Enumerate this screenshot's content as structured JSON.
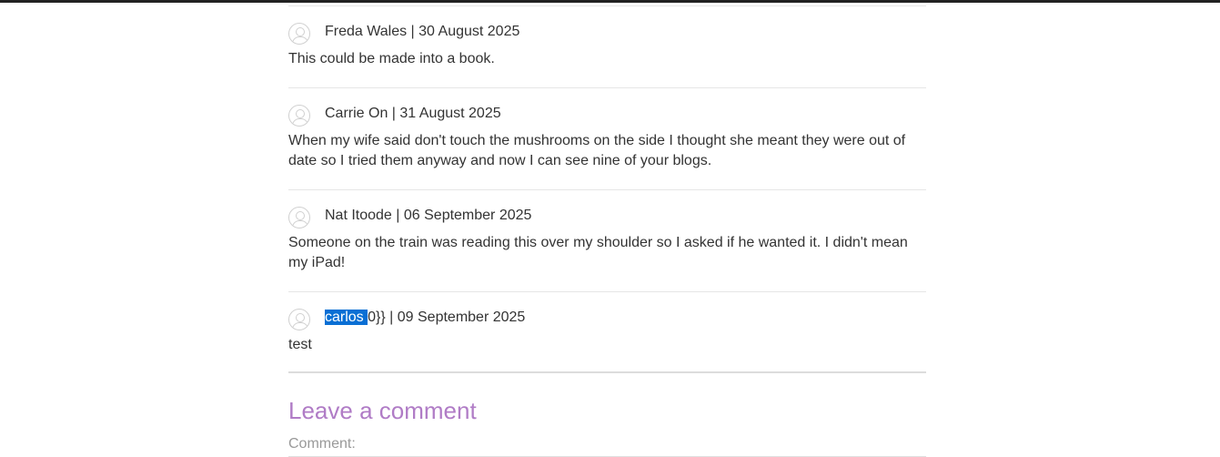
{
  "comments": [
    {
      "author": "Freda Wales",
      "separator": " | ",
      "date": "30 August 2025",
      "body": "This could be made into a book."
    },
    {
      "author": "Carrie On",
      "separator": " | ",
      "date": "31 August 2025",
      "body": "When my wife said don't touch the mushrooms on the side I thought she meant they were out of date so I tried them anyway and now I can see nine of your blogs."
    },
    {
      "author": "Nat Itoode",
      "separator": " | ",
      "date": "06 September 2025",
      "body": "Someone on the train was reading this over my shoulder so I asked if he wanted it. I didn't mean my iPad!"
    },
    {
      "author_selected": "carlos ",
      "author_rest": "0}}",
      "separator": " | ",
      "date": "09 September 2025",
      "body": "test"
    }
  ],
  "leave_comment": {
    "heading": "Leave a comment",
    "comment_label": "Comment:"
  },
  "colors": {
    "heading": "#b07cc6",
    "selection": "#0a6fd4",
    "text": "#333333"
  }
}
